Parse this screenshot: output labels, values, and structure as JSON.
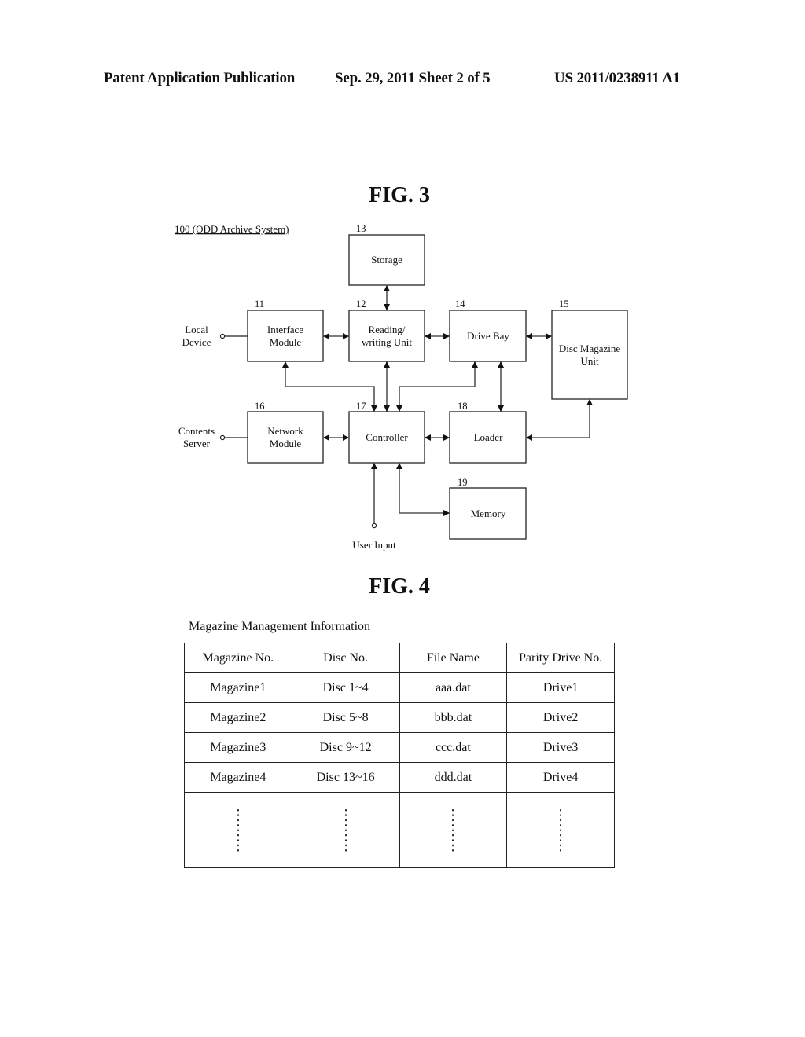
{
  "header": {
    "publication": "Patent Application Publication",
    "date_sheet": "Sep. 29, 2011   Sheet 2 of 5",
    "number": "US 2011/0238911 A1"
  },
  "fig3": {
    "title": "FIG. 3",
    "system_label": "100 (ODD Archive System)",
    "blocks": {
      "interface": {
        "ref": "11",
        "line1": "Interface",
        "line2": "Module"
      },
      "rw": {
        "ref": "12",
        "line1": "Reading/",
        "line2": "writing Unit"
      },
      "storage": {
        "ref": "13",
        "line1": "Storage"
      },
      "drivebay": {
        "ref": "14",
        "line1": "Drive Bay"
      },
      "magazine": {
        "ref": "15",
        "line1": "Disc Magazine",
        "line2": "Unit"
      },
      "network": {
        "ref": "16",
        "line1": "Network",
        "line2": "Module"
      },
      "controller": {
        "ref": "17",
        "line1": "Controller"
      },
      "loader": {
        "ref": "18",
        "line1": "Loader"
      },
      "memory": {
        "ref": "19",
        "line1": "Memory"
      }
    },
    "terminals": {
      "local_device": {
        "line1": "Local",
        "line2": "Device"
      },
      "contents_server": {
        "line1": "Contents",
        "line2": "Server"
      },
      "user_input": {
        "line1": "User Input"
      }
    }
  },
  "fig4": {
    "title": "FIG. 4",
    "caption": "Magazine Management Information",
    "columns": [
      "Magazine No.",
      "Disc No.",
      "File Name",
      "Parity Drive No."
    ],
    "rows": [
      [
        "Magazine1",
        "Disc 1~4",
        "aaa.dat",
        "Drive1"
      ],
      [
        "Magazine2",
        "Disc 5~8",
        "bbb.dat",
        "Drive2"
      ],
      [
        "Magazine3",
        "Disc 9~12",
        "ccc.dat",
        "Drive3"
      ],
      [
        "Magazine4",
        "Disc 13~16",
        "ddd.dat",
        "Drive4"
      ]
    ],
    "continuation": "vertical-ellipsis"
  }
}
